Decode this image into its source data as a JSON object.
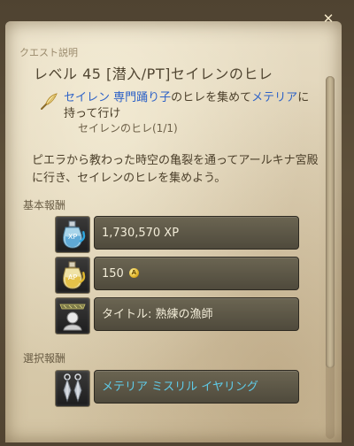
{
  "window": {
    "header_label": "クエスト説明",
    "close_glyph": "✕",
    "close_label": "×"
  },
  "quest": {
    "title": "レベル 45 [潜入/PT]セイレンのヒレ",
    "objective": {
      "part1": "セイレン",
      "part2": " 専門踊り子",
      "part3": "のヒレを集めて",
      "part4": "メテリア",
      "part5": "に",
      "line2": "持って行け"
    },
    "progress": "セイレンのヒレ(1/1)",
    "description": "ピエラから教わった時空の亀裂を通ってアールキナ宮殿に行き、セイレンのヒレを集めよう。"
  },
  "rewards": {
    "basic_label": "基本報酬",
    "xp": "1,730,570  XP",
    "ap": "150",
    "title_reward": "タイトル:  熟練の漁師",
    "choice_label": "選択報酬",
    "choice_item": "メテリア  ミスリル  イヤリング"
  },
  "icons": {
    "close": "close-icon",
    "quill": "quill-icon",
    "xp": "xp-potion-icon",
    "ap": "ap-potion-icon",
    "title": "title-badge-icon",
    "earring": "earring-icon",
    "ap_coin": "ap-coin-icon"
  },
  "colors": {
    "highlight_blue": "#2f63c7",
    "reward_cyan": "#5fcbe8",
    "parchment": "#ddd0b3"
  }
}
